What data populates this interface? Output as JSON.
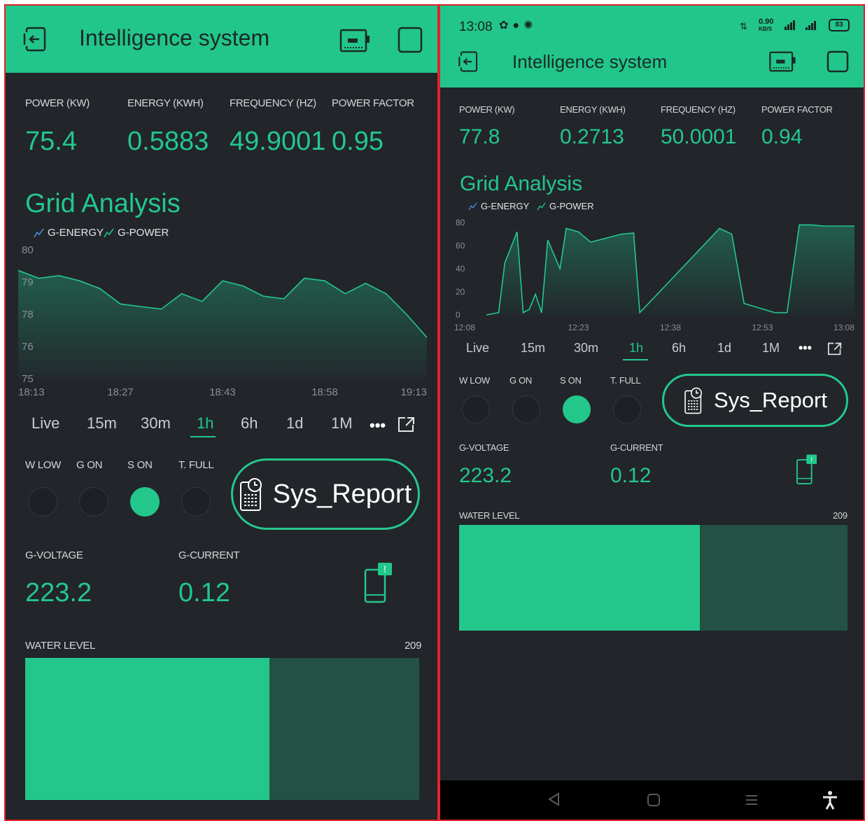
{
  "app": {
    "title": "Intelligence system",
    "accent_color": "#23c78c",
    "background_color": "#22252a"
  },
  "icons": {
    "back": "exit-app-icon",
    "device": "device-icon",
    "window": "square-icon",
    "report": "report-clock-icon",
    "notify": "phone-notification-icon",
    "fullscreen": "expand-icon",
    "more": "more-dots-icon"
  },
  "left": {
    "metrics": [
      {
        "label": "POWER (KW)",
        "value": "75.4"
      },
      {
        "label": "ENERGY (KWH)",
        "value": "0.5883"
      },
      {
        "label": "FREQUENCY (HZ)",
        "value": "49.9001"
      },
      {
        "label": "POWER FACTOR",
        "value": "0.95"
      }
    ],
    "periods": [
      "Live",
      "15m",
      "30m",
      "1h",
      "6h",
      "1d",
      "1M"
    ],
    "selected_period": "1h",
    "leds": [
      {
        "label": "W LOW",
        "on": false
      },
      {
        "label": "G ON",
        "on": false
      },
      {
        "label": "S ON",
        "on": true
      },
      {
        "label": "T. FULL",
        "on": false
      }
    ],
    "sys_report_label": "Sys_Report",
    "gvoltage": {
      "label": "G-VOLTAGE",
      "value": "223.2"
    },
    "gcurrent": {
      "label": "G-CURRENT",
      "value": "0.12"
    },
    "water": {
      "label": "WATER LEVEL",
      "max_label": "209",
      "fill_fraction": 0.62
    }
  },
  "right": {
    "status": {
      "time": "13:08",
      "net_speed": "0.90",
      "net_unit": "KB/S",
      "battery": "83"
    },
    "metrics": [
      {
        "label": "POWER (KW)",
        "value": "77.8"
      },
      {
        "label": "ENERGY (KWH)",
        "value": "0.2713"
      },
      {
        "label": "FREQUENCY (HZ)",
        "value": "50.0001"
      },
      {
        "label": "POWER FACTOR",
        "value": "0.94"
      }
    ],
    "periods": [
      "Live",
      "15m",
      "30m",
      "1h",
      "6h",
      "1d",
      "1M"
    ],
    "selected_period": "1h",
    "leds": [
      {
        "label": "W LOW",
        "on": false
      },
      {
        "label": "G ON",
        "on": false
      },
      {
        "label": "S ON",
        "on": true
      },
      {
        "label": "T. FULL",
        "on": false
      }
    ],
    "sys_report_label": "Sys_Report",
    "gvoltage": {
      "label": "G-VOLTAGE",
      "value": "223.2"
    },
    "gcurrent": {
      "label": "G-CURRENT",
      "value": "0.12"
    },
    "water": {
      "label": "WATER LEVEL",
      "max_label": "209",
      "fill_fraction": 0.62
    }
  },
  "chart_data": [
    {
      "type": "area",
      "title": "Grid Analysis",
      "legend": [
        "G-ENERGY",
        "G-POWER"
      ],
      "legend_placement": "top-left",
      "y_ticks": [
        "80",
        "79",
        "78",
        "76",
        "75"
      ],
      "x_ticks": [
        "18:13",
        "18:27",
        "18:43",
        "18:58",
        "19:13"
      ],
      "ylim": [
        75,
        80
      ],
      "series": [
        {
          "name": "G-POWER",
          "color": "#23c78c",
          "x": [
            0,
            3,
            6,
            9,
            12,
            15,
            18,
            21,
            24,
            27,
            30,
            33,
            36,
            39,
            42,
            45,
            48,
            51,
            54,
            57,
            60
          ],
          "values": [
            79.2,
            78.9,
            79.0,
            78.8,
            78.5,
            77.9,
            77.8,
            77.7,
            78.3,
            78.0,
            78.8,
            78.6,
            78.2,
            78.1,
            78.9,
            78.8,
            78.3,
            78.7,
            78.3,
            77.5,
            76.6
          ]
        }
      ]
    },
    {
      "type": "area",
      "title": "Grid Analysis",
      "legend": [
        "G-ENERGY",
        "G-POWER"
      ],
      "legend_placement": "top-left",
      "y_ticks": [
        "80",
        "60",
        "40",
        "20",
        "0"
      ],
      "x_ticks": [
        "12:08",
        "12:23",
        "12:38",
        "12:53",
        "13:08"
      ],
      "ylim": [
        0,
        80
      ],
      "series": [
        {
          "name": "G-POWER",
          "color": "#23c78c",
          "x": [
            0,
            2,
            3,
            5,
            6,
            7,
            8,
            9,
            10,
            12,
            13,
            15,
            17,
            22,
            24,
            25,
            30,
            38,
            40,
            42,
            47,
            49,
            51,
            53,
            55,
            60
          ],
          "values": [
            0,
            2,
            45,
            72,
            2,
            5,
            18,
            2,
            65,
            40,
            75,
            72,
            63,
            70,
            71,
            2,
            30,
            75,
            70,
            10,
            2,
            2,
            78,
            78,
            77,
            77
          ]
        }
      ]
    }
  ]
}
